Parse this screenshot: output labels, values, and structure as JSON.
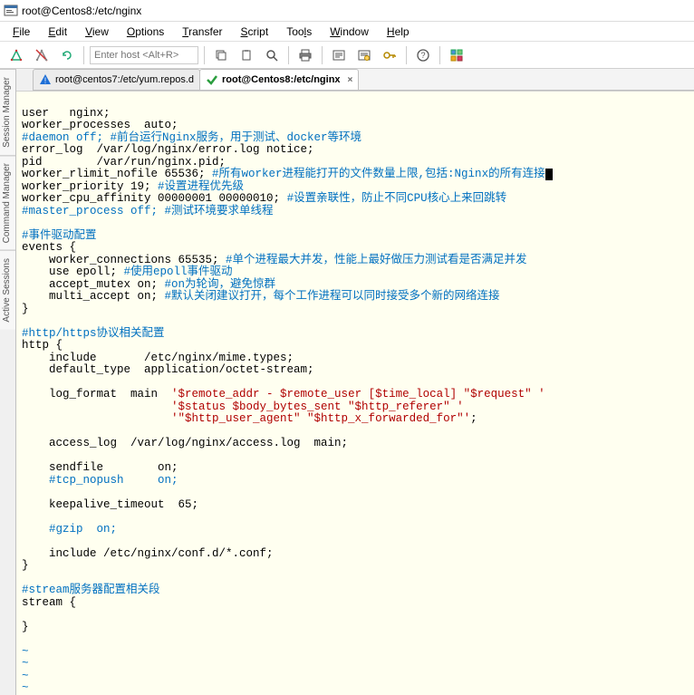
{
  "window": {
    "title": "root@Centos8:/etc/nginx"
  },
  "menu": {
    "file": "File",
    "edit": "Edit",
    "view": "View",
    "options": "Options",
    "transfer": "Transfer",
    "script": "Script",
    "tools": "Tools",
    "window": "Window",
    "help": "Help"
  },
  "toolbar": {
    "host_placeholder": "Enter host <Alt+R>"
  },
  "tabs": {
    "t1": "root@centos7:/etc/yum.repos.d",
    "t2": "root@Centos8:/etc/nginx",
    "close": "×"
  },
  "side": {
    "session_manager": "Session Manager",
    "command_manager": "Command Manager",
    "active_sessions": "Active Sessions"
  },
  "term": {
    "l1": "user   nginx;",
    "l2": "worker_processes  auto;",
    "l3a": "#daemon off;",
    "l3b": " #前台运行Nginx服务，用于测试、docker等环境",
    "l4": "error_log  /var/log/nginx/error.log notice;",
    "l5": "pid        /var/run/nginx.pid;",
    "l6a": "worker_rlimit_nofile 65536; ",
    "l6b": "#所有worker进程能打开的文件数量上限,包括:Nginx的所有连接",
    "l7a": "worker_priority 19; ",
    "l7b": "#设置进程优先级",
    "l8a": "worker_cpu_affinity 00000001 00000010; ",
    "l8b": "#设置亲联性，防止不同CPU核心上来回跳转",
    "l9a": "#master_process off;",
    "l9b": " #测试环境要求单线程",
    "l10": "",
    "l11": "#事件驱动配置",
    "l12": "events {",
    "l13a": "    worker_connections 65535; ",
    "l13b": "#单个进程最大并发，性能上最好做压力测试看是否满足并发",
    "l14a": "    use epoll; ",
    "l14b": "#使用epoll事件驱动",
    "l15a": "    accept_mutex on; ",
    "l15b": "#on为轮询，避免惊群",
    "l16a": "    multi_accept on; ",
    "l16b": "#默认关闭建议打开，每个工作进程可以同时接受多个新的网络连接",
    "l17": "}",
    "l18": "",
    "l19": "#http/https协议相关配置",
    "l20": "http {",
    "l21": "    include       /etc/nginx/mime.types;",
    "l22": "    default_type  application/octet-stream;",
    "l23": "",
    "l24a": "    log_format  main  ",
    "l24b": "'$remote_addr - $remote_user [$time_local] \"$request\" '",
    "l25": "                      '$status $body_bytes_sent \"$http_referer\" '",
    "l26a": "                      '\"$http_user_agent\" \"$http_x_forwarded_for\"'",
    "l26b": ";",
    "l27": "",
    "l28": "    access_log  /var/log/nginx/access.log  main;",
    "l29": "",
    "l30": "    sendfile        on;",
    "l31": "    #tcp_nopush     on;",
    "l32": "",
    "l33": "    keepalive_timeout  65;",
    "l34": "",
    "l35": "    #gzip  on;",
    "l36": "",
    "l37": "    include /etc/nginx/conf.d/*.conf;",
    "l38": "}",
    "l39": "",
    "l40": "#stream服务器配置相关段",
    "l41": "stream {",
    "l42": "",
    "l43": "}",
    "l44": "",
    "tilde": "~"
  }
}
